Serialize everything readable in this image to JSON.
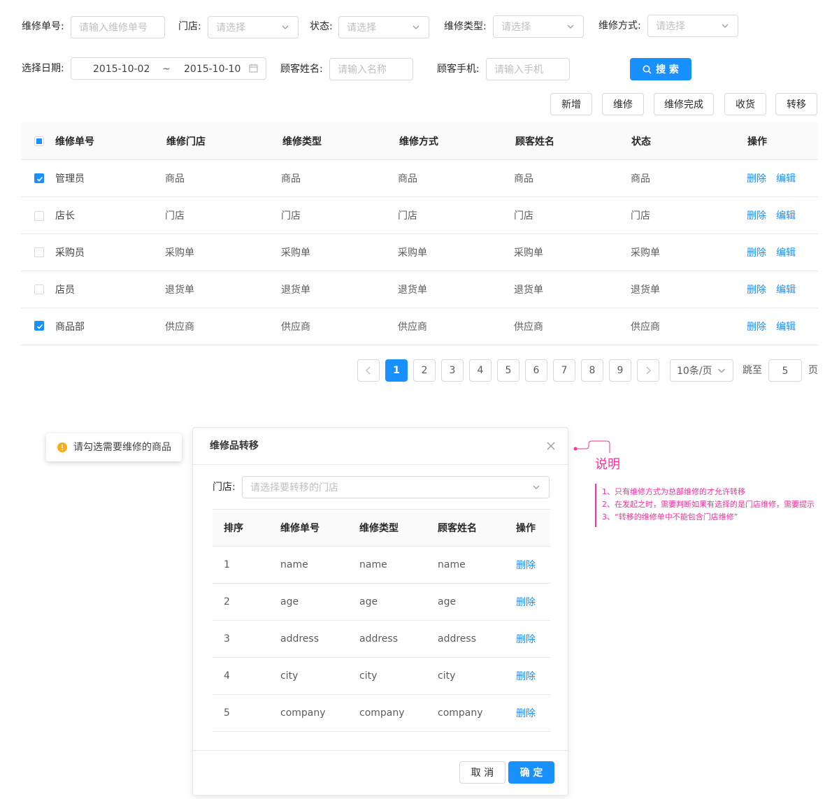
{
  "filters": {
    "order_no": {
      "label": "维修单号:",
      "placeholder": "请输入维修单号"
    },
    "store": {
      "label": "门店:",
      "placeholder": "请选择"
    },
    "status": {
      "label": "状态:",
      "placeholder": "请选择"
    },
    "repair_type": {
      "label": "维修类型:",
      "placeholder": "请选择"
    },
    "repair_method": {
      "label": "维修方式:",
      "placeholder": "请选择"
    },
    "date": {
      "label": "选择日期:",
      "start": "2015-10-02",
      "separator": "~",
      "end": "2015-10-10"
    },
    "customer_name": {
      "label": "顾客姓名:",
      "placeholder": "请输入名称"
    },
    "customer_phone": {
      "label": "顾客手机:",
      "placeholder": "请输入手机"
    },
    "search_label": "搜 索"
  },
  "actions": {
    "add": "新增",
    "repair": "维修",
    "repair_done": "维修完成",
    "receive": "收货",
    "transfer": "转移"
  },
  "table": {
    "columns": [
      "维修单号",
      "维修门店",
      "维修类型",
      "维修方式",
      "顾客姓名",
      "状态",
      "操作"
    ],
    "rows": [
      {
        "checked": true,
        "cells": [
          "管理员",
          "商品",
          "商品",
          "商品",
          "商品",
          "商品"
        ],
        "delete": "删除",
        "edit": "编辑"
      },
      {
        "checked": false,
        "cells": [
          "店长",
          "门店",
          "门店",
          "门店",
          "门店",
          "门店"
        ],
        "delete": "删除",
        "edit": "编辑"
      },
      {
        "checked": false,
        "cells": [
          "采购员",
          "采购单",
          "采购单",
          "采购单",
          "采购单",
          "采购单"
        ],
        "delete": "删除",
        "edit": "编辑"
      },
      {
        "checked": false,
        "cells": [
          "店员",
          "退货单",
          "退货单",
          "退货单",
          "退货单",
          "退货单"
        ],
        "delete": "删除",
        "edit": "编辑"
      },
      {
        "checked": true,
        "cells": [
          "商品部",
          "供应商",
          "供应商",
          "供应商",
          "供应商",
          "供应商"
        ],
        "delete": "删除",
        "edit": "编辑"
      }
    ]
  },
  "pagination": {
    "pages": [
      "1",
      "2",
      "3",
      "4",
      "5",
      "6",
      "7",
      "8",
      "9"
    ],
    "current": "1",
    "page_size": "10条/页",
    "jump_label": "跳至",
    "jump_value": "5",
    "page_suffix": "页"
  },
  "toast": {
    "message": "请勾选需要维修的商品",
    "color": "#faad14"
  },
  "modal": {
    "title": "维修品转移",
    "store_label": "门店:",
    "store_placeholder": "请选择要转移的门店",
    "columns": [
      "排序",
      "维修单号",
      "维修类型",
      "顾客姓名",
      "操作"
    ],
    "rows": [
      {
        "order": "1",
        "no": "name",
        "type": "name",
        "customer": "name",
        "action": "删除"
      },
      {
        "order": "2",
        "no": "age",
        "type": "age",
        "customer": "age",
        "action": "删除"
      },
      {
        "order": "3",
        "no": "address",
        "type": "address",
        "customer": "address",
        "action": "删除"
      },
      {
        "order": "4",
        "no": "city",
        "type": "city",
        "customer": "city",
        "action": "删除"
      },
      {
        "order": "5",
        "no": "company",
        "type": "company",
        "customer": "company",
        "action": "删除"
      }
    ],
    "cancel": "取 消",
    "confirm": "确 定"
  },
  "note": {
    "title": "说明",
    "lines": [
      "1、只有维修方式为总部维修的才允许转移",
      "2、在发起之时，需要判断如果有选择的是门店维修，需要提示",
      "3、“转移的维修单中不能包含门店维修”"
    ],
    "color": "#f5319d"
  },
  "colors": {
    "primary": "#1890ff",
    "border": "#d9d9d9",
    "header_bg": "#fafafa"
  }
}
